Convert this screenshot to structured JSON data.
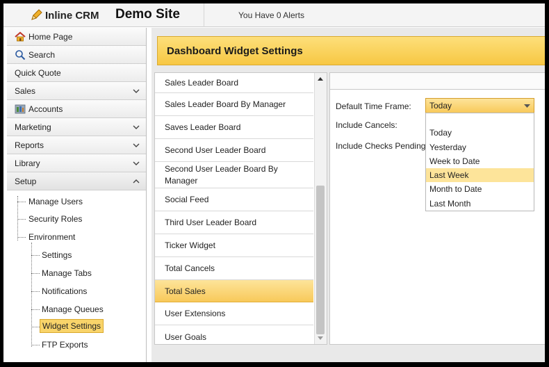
{
  "header": {
    "logo_text": "Inline CRM",
    "site_name": "Demo Site",
    "alerts_text": "You Have 0 Alerts"
  },
  "sidebar": {
    "items": [
      {
        "label": "Home Page",
        "icon": "home-icon"
      },
      {
        "label": "Search",
        "icon": "search-icon"
      },
      {
        "label": "Quick Quote"
      },
      {
        "label": "Sales",
        "chevron": "down"
      },
      {
        "label": "Accounts",
        "icon": "accounts-icon"
      },
      {
        "label": "Marketing",
        "chevron": "down"
      },
      {
        "label": "Reports",
        "chevron": "down"
      },
      {
        "label": "Library",
        "chevron": "down"
      },
      {
        "label": "Setup",
        "chevron": "up"
      }
    ],
    "tree": {
      "manage_users": "Manage Users",
      "security_roles": "Security Roles",
      "environment": "Environment",
      "settings": "Settings",
      "manage_tabs": "Manage Tabs",
      "notifications": "Notifications",
      "manage_queues": "Manage Queues",
      "widget_settings": "Widget Settings",
      "ftp_exports": "FTP Exports"
    }
  },
  "page": {
    "title": "Dashboard Widget Settings"
  },
  "widget_list": {
    "items": [
      "Sales Leader Board",
      "Sales Leader Board By Manager",
      "Saves Leader Board",
      "Second User Leader Board",
      "Second User Leader Board By Manager",
      "Social Feed",
      "Third User Leader Board",
      "Ticker Widget",
      "Total Cancels",
      "Total Sales",
      "User Extensions",
      "User Goals"
    ],
    "selected": "Total Sales"
  },
  "settings": {
    "default_time_frame_label": "Default Time Frame:",
    "include_cancels_label": "Include Cancels:",
    "include_checks_pending_label": "Include Checks Pending:",
    "time_frame_value": "Today",
    "time_frame_options": [
      "Today",
      "Yesterday",
      "Week to Date",
      "Last Week",
      "Month to Date",
      "Last Month"
    ],
    "highlighted_option": "Last Week"
  },
  "colors": {
    "accent": "#f8c95a",
    "accent_light": "#fde49a",
    "accent_border": "#d9a92e"
  }
}
